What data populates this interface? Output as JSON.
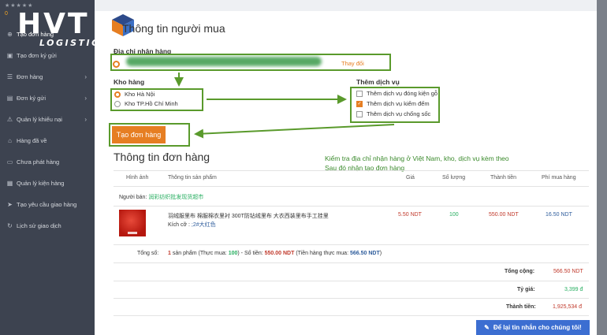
{
  "sidebar": {
    "rating_zero": "0",
    "items": [
      {
        "label": "Tạo đơn hàng",
        "icon": "cart-icon",
        "active": true,
        "chevron": false
      },
      {
        "label": "Tạo đơn ký gửi",
        "icon": "box-icon",
        "chevron": false
      },
      {
        "label": "Đơn hàng",
        "icon": "list-icon",
        "chevron": true
      },
      {
        "label": "Đơn ký gửi",
        "icon": "folder-icon",
        "chevron": true
      },
      {
        "label": "Quản lý khiếu nại",
        "icon": "warning-icon",
        "chevron": true
      },
      {
        "label": "Hàng đã về",
        "icon": "home-icon",
        "chevron": false
      },
      {
        "label": "Chưa phát hàng",
        "icon": "truck-icon",
        "chevron": false
      },
      {
        "label": "Quản lý kiện hàng",
        "icon": "package-icon",
        "chevron": false
      },
      {
        "label": "Tạo yêu cầu giao hàng",
        "icon": "send-icon",
        "chevron": false
      },
      {
        "label": "Lịch sử giao dịch",
        "icon": "history-icon",
        "chevron": false
      }
    ]
  },
  "logo": {
    "brand": "HVT",
    "sub": "LOGISTICS"
  },
  "buyer": {
    "title": "Thông tin người mua",
    "address_label": "Địa chỉ nhận hàng",
    "change_label": "Thay đổi",
    "warehouse_label": "Kho hàng",
    "warehouses": [
      "Kho Hà Nội",
      "Kho TP.Hồ Chí Minh"
    ],
    "service_label": "Thêm dịch vụ",
    "services": [
      {
        "label": "Thêm dịch vụ đóng kiện gỗ",
        "checked": false
      },
      {
        "label": "Thêm dịch vụ kiểm đếm",
        "checked": true
      },
      {
        "label": "Thêm dịch vụ chống sốc",
        "checked": false
      }
    ],
    "create_button": "Tạo đơn hàng"
  },
  "order": {
    "title": "Thông tin đơn hàng",
    "note_line1": "Kiểm tra địa chỉ nhận hàng ở Việt Nam, kho, dịch vụ kèm theo",
    "note_line2": "Sau đó nhận tạo đơn hàng",
    "headers": [
      "Hình ảnh",
      "Thông tin sản phẩm",
      "Giá",
      "Số lượng",
      "Thành tiền",
      "Phí mua hàng"
    ],
    "seller_label": "Người bán:",
    "seller_name": "润彩纺织批发现货超市",
    "product_name": "羽绒服里布 棉服棉衣里衬 300T防钻绒里布 大衣西装里布手工挂里",
    "size_label": "Kích cỡ :",
    "size_value": ";2#大红色",
    "price": "5.50 NDT",
    "qty": "100",
    "amount": "550.00 NDT",
    "fee": "16.50 NDT",
    "total_label": "Tổng số:",
    "total_text_a": "1",
    "total_text_b": "sản phẩm (Thực mua:",
    "total_text_c": "100",
    "total_text_d": ") - Số tiền:",
    "total_text_e": "550.00 NDT",
    "total_text_f": "(Tiền hàng thực mua:",
    "total_text_g": "566.50 NDT",
    "total_text_h": ")",
    "sum_label": "Tổng cộng:",
    "sum_value": "566.50 NDT",
    "rate_label": "Tỷ giá:",
    "rate_value": "3,399 đ",
    "final_label": "Thành tiền:",
    "final_value": "1,925,534 đ"
  },
  "chat": {
    "label": "Để lại tin nhắn cho chúng tôi!"
  }
}
